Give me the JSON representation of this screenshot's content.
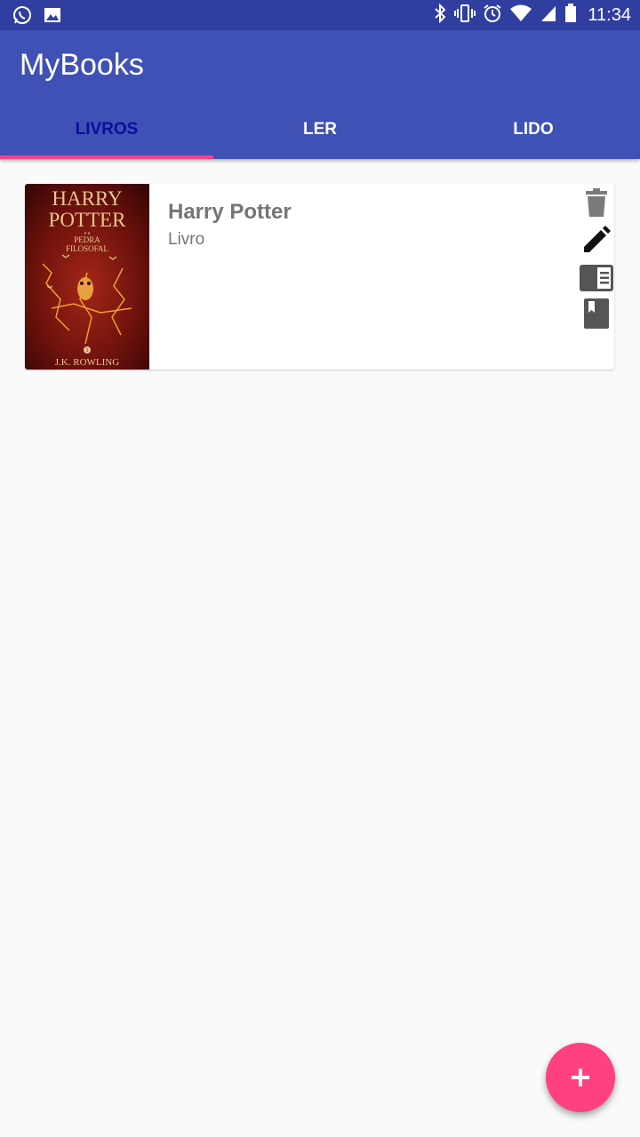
{
  "status_bar": {
    "time": "11:34",
    "left_icons": [
      "whatsapp-icon",
      "image-icon"
    ],
    "right_icons": [
      "bluetooth-icon",
      "vibrate-icon",
      "alarm-icon",
      "wifi-icon",
      "signal-icon",
      "battery-icon"
    ]
  },
  "app_bar": {
    "title": "MyBooks",
    "tabs": [
      {
        "label": "LIVROS",
        "active": true
      },
      {
        "label": "LER",
        "active": false
      },
      {
        "label": "LIDO",
        "active": false
      }
    ]
  },
  "books": [
    {
      "title": "Harry Potter",
      "type": "Livro",
      "cover": {
        "line1": "HARRY",
        "line2": "POTTER",
        "small1": "e a",
        "small2": "PEDRA",
        "small3": "FILOSOFAL",
        "number": "1",
        "author": "J.K. ROWLING"
      },
      "actions": [
        "delete-icon",
        "edit-icon",
        "reading-icon",
        "read-icon"
      ]
    }
  ],
  "fab": {
    "icon": "add-icon",
    "label": "+"
  },
  "colors": {
    "primary": "#3f51b5",
    "primary_dark": "#303f9f",
    "accent": "#ff4081",
    "active_tab_text": "#0d0d9c",
    "background": "#fafafa"
  }
}
